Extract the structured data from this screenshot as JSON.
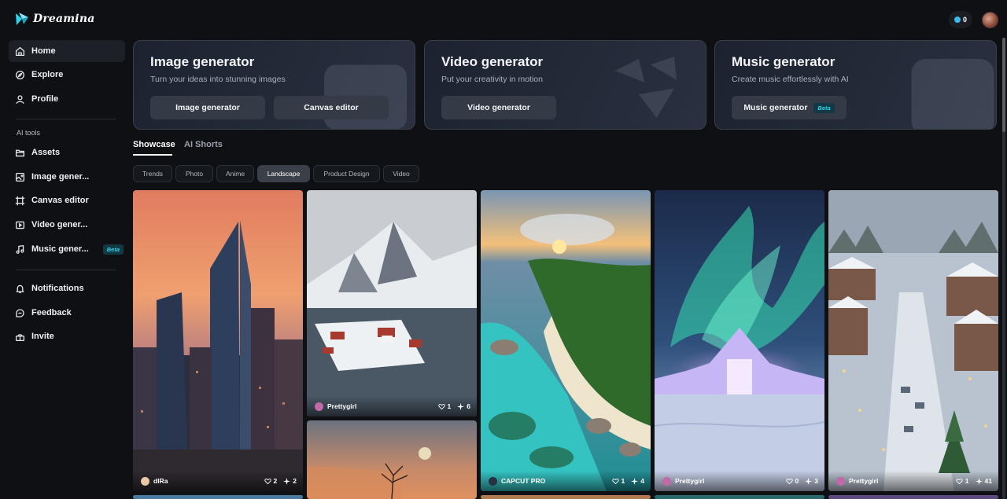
{
  "app": {
    "name": "Dreamina"
  },
  "header": {
    "credits": "0"
  },
  "sidebar": {
    "items": [
      {
        "label": "Home",
        "icon": "home-icon"
      },
      {
        "label": "Explore",
        "icon": "compass-icon"
      },
      {
        "label": "Profile",
        "icon": "user-icon"
      }
    ],
    "section_label": "AI tools",
    "tools": [
      {
        "label": "Assets",
        "icon": "folder-icon"
      },
      {
        "label": "Image gener...",
        "icon": "image-plus-icon"
      },
      {
        "label": "Canvas editor",
        "icon": "canvas-icon"
      },
      {
        "label": "Video gener...",
        "icon": "video-icon"
      },
      {
        "label": "Music gener...",
        "icon": "music-icon",
        "badge": "Beta"
      }
    ],
    "bottom": [
      {
        "label": "Notifications",
        "icon": "bell-icon"
      },
      {
        "label": "Feedback",
        "icon": "feedback-icon"
      },
      {
        "label": "Invite",
        "icon": "invite-icon"
      }
    ]
  },
  "cards": [
    {
      "title": "Image generator",
      "subtitle": "Turn your ideas into stunning images",
      "buttons": [
        "Image generator",
        "Canvas editor"
      ]
    },
    {
      "title": "Video generator",
      "subtitle": "Put your creativity in motion",
      "buttons": [
        "Video generator"
      ]
    },
    {
      "title": "Music generator",
      "subtitle": "Create music effortlessly with AI",
      "buttons": [
        "Music generator"
      ],
      "badge": "Beta"
    }
  ],
  "tabs": [
    "Showcase",
    "AI Shorts"
  ],
  "filters": [
    "Trends",
    "Photo",
    "Anime",
    "Landscape",
    "Product Design",
    "Video"
  ],
  "active_filter": "Landscape",
  "gallery": [
    {
      "author": "dIRa",
      "likes": "2",
      "remixes": "2",
      "scene": "city-sunset"
    },
    {
      "author": "Prettygirl",
      "likes": "1",
      "remixes": "6",
      "scene": "snowy-mountain-village"
    },
    {
      "author": "",
      "likes": "",
      "remixes": "",
      "scene": "moon-tree-sunset"
    },
    {
      "author": "CAPCUT PRO",
      "likes": "1",
      "remixes": "4",
      "scene": "tropical-beach"
    },
    {
      "author": "Prettygirl",
      "likes": "0",
      "remixes": "3",
      "scene": "aurora-ice-castle"
    },
    {
      "author": "Prettygirl",
      "likes": "1",
      "remixes": "41",
      "scene": "snowy-christmas-town"
    }
  ],
  "colors": {
    "accent": "#2fd0e8",
    "background": "#0e1014",
    "active_chip": "#3a3f49"
  }
}
